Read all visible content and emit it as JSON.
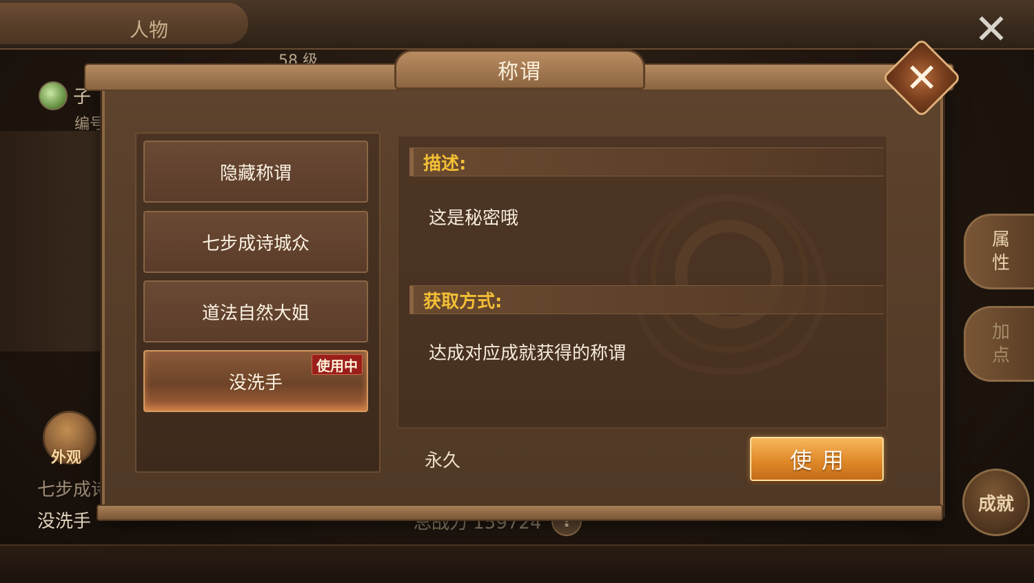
{
  "background": {
    "tab_label": "人物",
    "level": "58 级",
    "player_name": "子",
    "player_id_label": "编号",
    "appearance_label": "外观",
    "title_line1": "七步成诗",
    "title_line2": "没洗手",
    "power_text": "总战力 159724",
    "power_badge": "!",
    "side_tabs": [
      {
        "label": "属性"
      },
      {
        "label": "加点"
      }
    ],
    "achievement_label": "成就",
    "close_glyph": "✕"
  },
  "modal": {
    "title": "称谓",
    "close_glyph": "✕",
    "titles_list": [
      {
        "label": "隐藏称谓",
        "in_use": false
      },
      {
        "label": "七步成诗城众",
        "in_use": false
      },
      {
        "label": "道法自然大姐",
        "in_use": false
      },
      {
        "label": "没洗手",
        "in_use": true,
        "badge": "使用中"
      }
    ],
    "detail": {
      "description_header": "描述:",
      "description_text": "这是秘密哦",
      "acquire_header": "获取方式:",
      "acquire_text": "达成对应成就获得的称谓"
    },
    "duration": "永久",
    "use_button_label": "使用"
  },
  "colors": {
    "accent_gold": "#f3bf35",
    "button_orange": "#e08a2a",
    "badge_red": "#9a1f1b"
  }
}
